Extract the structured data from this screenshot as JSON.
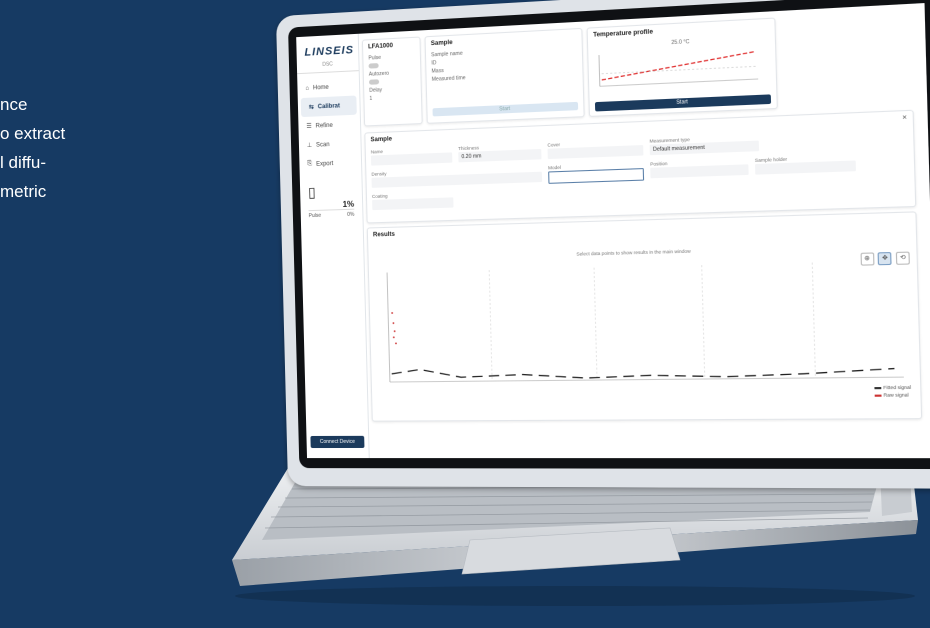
{
  "hero": {
    "lines": [
      "nce",
      "o extract",
      "l diffu-",
      "metric"
    ]
  },
  "app": {
    "logo": "LINSEIS",
    "logo_sub": "DSC",
    "nav": [
      {
        "label": "Home",
        "icon": "home-icon"
      },
      {
        "label": "Calibrat",
        "icon": "calibrate-icon"
      },
      {
        "label": "Refine",
        "icon": "refine-icon"
      },
      {
        "label": "Scan",
        "icon": "scan-icon"
      },
      {
        "label": "Export",
        "icon": "export-icon"
      }
    ],
    "device_pct": "1%",
    "device_label": "Pulse",
    "device_value": "0%",
    "sidebar_button": "Connect Device",
    "card1": {
      "title": "LFA1000",
      "labels": [
        "Pulse",
        "Autozero",
        "Delay"
      ],
      "value": "1"
    },
    "card2": {
      "title": "Sample",
      "lines": [
        "Sample name",
        "ID",
        "Mass",
        "Measured time"
      ],
      "button": "Start"
    },
    "card3": {
      "title": "Temperature profile",
      "value": "25.0 °C",
      "button": "Start"
    },
    "sample_form": {
      "title": "Sample",
      "close": "×",
      "fields": [
        {
          "label": "Name",
          "value": ""
        },
        {
          "label": "Thickness",
          "value": "0.20 mm"
        },
        {
          "label": "Cover",
          "value": ""
        },
        {
          "label": "Measurement type",
          "value": "Default measurement"
        },
        {
          "label": "Density",
          "value": ""
        },
        {
          "label": "Model",
          "value": ""
        },
        {
          "label": "Position",
          "value": ""
        },
        {
          "label": "Sample holder",
          "value": ""
        },
        {
          "label": "Coating",
          "value": ""
        }
      ]
    },
    "results": {
      "title": "Results",
      "hint": "Select data points to show results in the main window",
      "legend": [
        "Fitted signal",
        "Raw signal"
      ]
    }
  }
}
